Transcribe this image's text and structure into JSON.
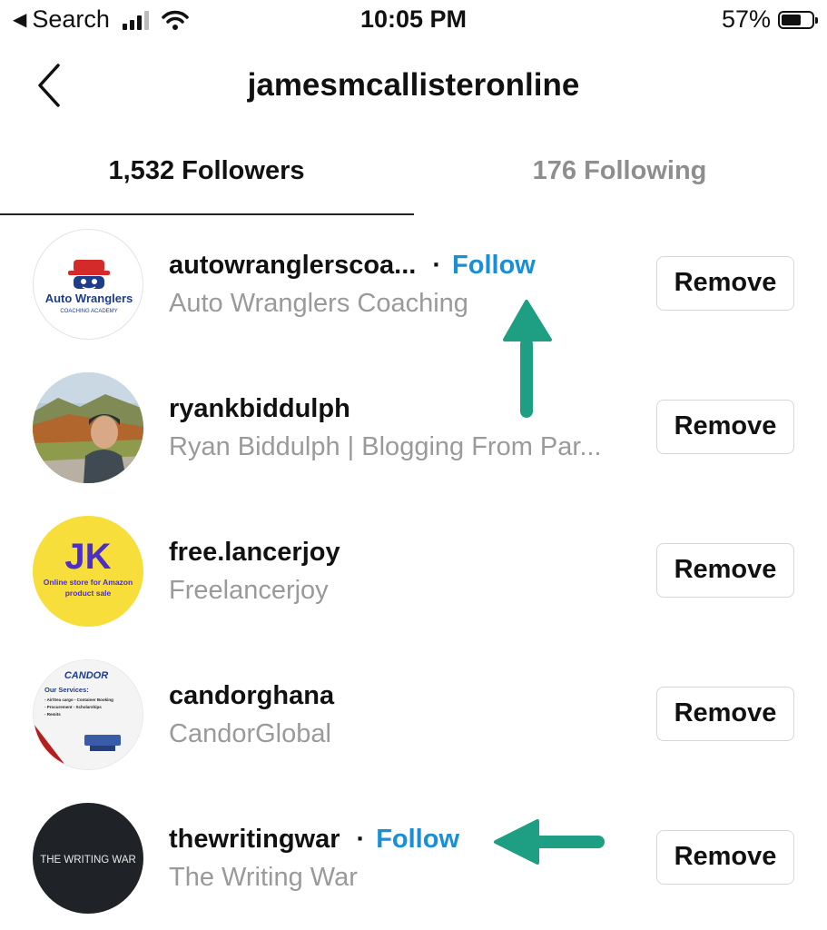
{
  "status_bar": {
    "back_app": "Search",
    "time": "10:05 PM",
    "battery_percent": "57%",
    "battery_level": 0.57,
    "icons": [
      "back-triangle-icon",
      "cellular-signal-icon",
      "wifi-icon",
      "battery-icon"
    ]
  },
  "header": {
    "title": "jamesmcallisteronline",
    "back_icon": "chevron-left-icon"
  },
  "tabs": {
    "followers": "1,532 Followers",
    "following": "176 Following",
    "active": "followers"
  },
  "followers": [
    {
      "username": "autowranglerscoa...",
      "fullname": "Auto Wranglers Coaching",
      "follow": "Follow",
      "remove": "Remove",
      "avatar": {
        "brand": "Auto Wranglers",
        "sub": "COACHING ACADEMY"
      }
    },
    {
      "username": "ryankbiddulph",
      "fullname": "Ryan Biddulph | Blogging From Par...",
      "remove": "Remove",
      "avatar": {
        "kind": "photo"
      }
    },
    {
      "username": "free.lancerjoy",
      "fullname": "Freelancerjoy",
      "remove": "Remove",
      "avatar": {
        "monogram": "JK",
        "line1": "Online store for Amazon",
        "line2": "product sale"
      }
    },
    {
      "username": "candorghana",
      "fullname": "CandorGlobal",
      "remove": "Remove",
      "avatar": {
        "brand": "CANDOR",
        "heading": "Our Services:",
        "line1": "- Air/Sea cargo - Container Booking",
        "line2": "- Procurement - Scholarships",
        "line3": "- Remits"
      }
    },
    {
      "username": "thewritingwar",
      "fullname": "The Writing War",
      "follow": "Follow",
      "remove": "Remove",
      "avatar": {
        "text": "THE WRITING WAR"
      }
    }
  ],
  "colors": {
    "follow_blue": "#1a8fd6",
    "annotation_arrow": "#1e9e82",
    "secondary_text": "#9a9a9a"
  }
}
